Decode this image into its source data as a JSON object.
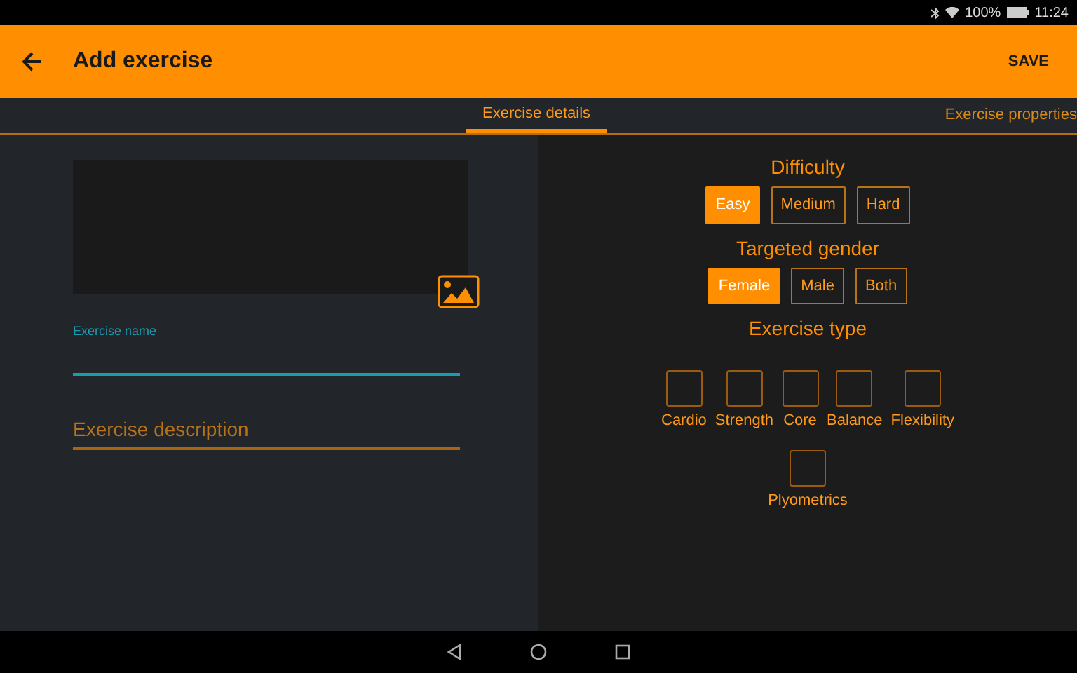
{
  "status_bar": {
    "battery": "100%",
    "time": "11:24"
  },
  "app_bar": {
    "title": "Add exercise",
    "action": "SAVE"
  },
  "tabs": [
    {
      "label": "Exercise details",
      "selected": true
    },
    {
      "label": "Exercise properties",
      "selected": false
    }
  ],
  "details": {
    "name_field": {
      "label": "Exercise name"
    },
    "description_field": {
      "placeholder": "Exercise description"
    }
  },
  "properties": {
    "difficulty": {
      "title": "Difficulty",
      "options": [
        {
          "label": "Easy",
          "selected": true
        },
        {
          "label": "Medium",
          "selected": false
        },
        {
          "label": "Hard",
          "selected": false
        }
      ]
    },
    "gender": {
      "title": "Targeted gender",
      "options": [
        {
          "label": "Female",
          "selected": true
        },
        {
          "label": "Male",
          "selected": false
        },
        {
          "label": "Both",
          "selected": false
        }
      ]
    },
    "types": {
      "title": "Exercise type",
      "items": [
        {
          "label": "Cardio",
          "checked": false
        },
        {
          "label": "Strength",
          "checked": false
        },
        {
          "label": "Core",
          "checked": false
        },
        {
          "label": "Balance",
          "checked": false
        },
        {
          "label": "Flexibility",
          "checked": false
        },
        {
          "label": "Plyometrics",
          "checked": false
        }
      ]
    }
  }
}
